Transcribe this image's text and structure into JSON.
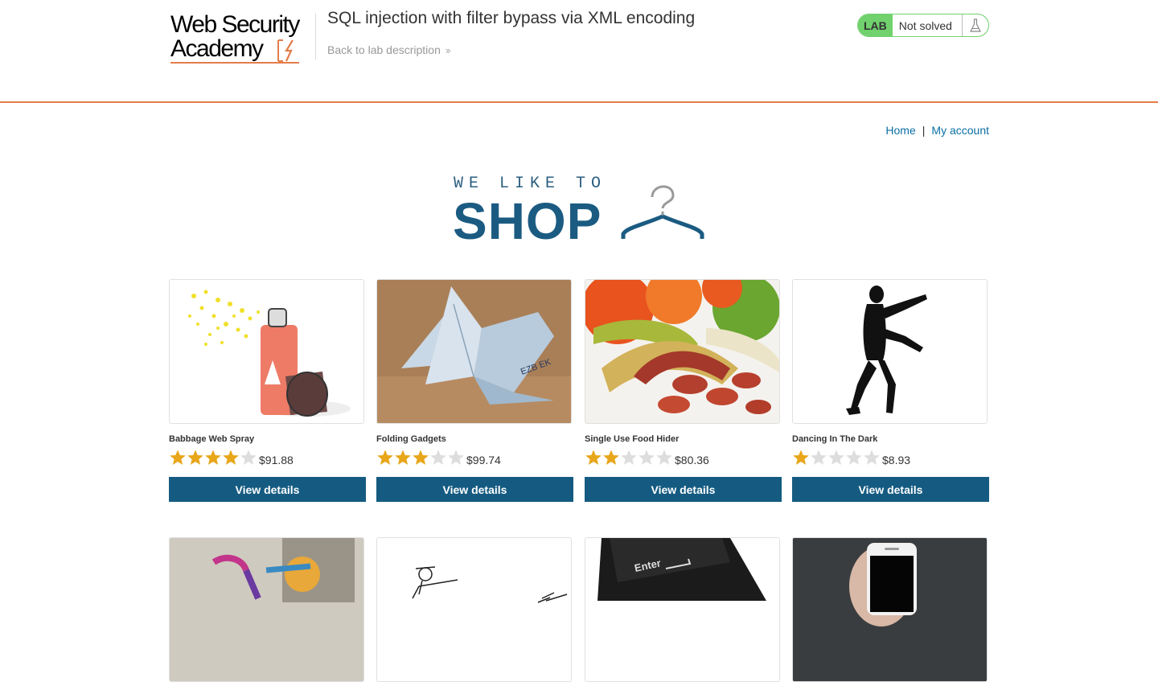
{
  "header": {
    "logo_line1": "Web Security",
    "logo_line2": "Academy",
    "lab_title": "SQL injection with filter bypass via XML encoding",
    "back_link": "Back to lab description",
    "lab_badge": "LAB",
    "lab_status": "Not solved"
  },
  "nav": {
    "home": "Home",
    "separator": "|",
    "my_account": "My account"
  },
  "banner": {
    "small_text": "WE LIKE TO",
    "big_text": "SHOP"
  },
  "colors": {
    "accent_orange": "#e47d4a",
    "button_blue": "#155b81",
    "link_blue": "#0b6fa4",
    "lab_green": "#70d16d",
    "star_gold": "#e8a61a",
    "star_grey": "#dddddd"
  },
  "products": [
    {
      "name": "Babbage Web Spray",
      "rating": 4,
      "max_rating": 5,
      "price": "$91.88",
      "button": "View details"
    },
    {
      "name": "Folding Gadgets",
      "rating": 3,
      "max_rating": 5,
      "price": "$99.74",
      "button": "View details"
    },
    {
      "name": "Single Use Food Hider",
      "rating": 2,
      "max_rating": 5,
      "price": "$80.36",
      "button": "View details"
    },
    {
      "name": "Dancing In The Dark",
      "rating": 1,
      "max_rating": 5,
      "price": "$8.93",
      "button": "View details"
    }
  ],
  "images_row2": [
    {
      "icon": "knitted-bike-image"
    },
    {
      "icon": "sketch-figure-image"
    },
    {
      "icon": "enter-key-image"
    },
    {
      "icon": "smartphone-image"
    }
  ]
}
